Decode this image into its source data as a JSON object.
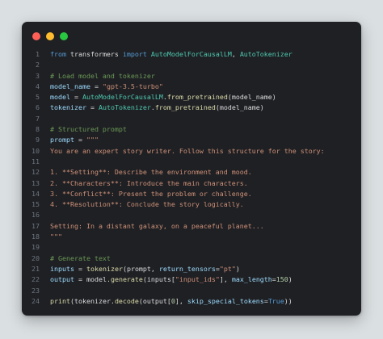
{
  "window": {
    "buttons": [
      "close",
      "minimize",
      "maximize"
    ],
    "colors": {
      "close": "#ff5f57",
      "minimize": "#febc2e",
      "maximize": "#28c840",
      "background": "#1f2024"
    }
  },
  "code_lines": [
    {
      "n": "1",
      "tokens": [
        [
          "kw",
          "from"
        ],
        [
          "plain",
          " transformers "
        ],
        [
          "kw",
          "import"
        ],
        [
          "plain",
          " "
        ],
        [
          "cls",
          "AutoModelForCausalLM"
        ],
        [
          "plain",
          ", "
        ],
        [
          "cls",
          "AutoTokenizer"
        ]
      ]
    },
    {
      "n": "2",
      "tokens": []
    },
    {
      "n": "3",
      "tokens": [
        [
          "com",
          "# Load model and tokenizer"
        ]
      ]
    },
    {
      "n": "4",
      "tokens": [
        [
          "var",
          "model_name"
        ],
        [
          "plain",
          " = "
        ],
        [
          "str",
          "\"gpt-3.5-turbo\""
        ]
      ]
    },
    {
      "n": "5",
      "tokens": [
        [
          "var",
          "model"
        ],
        [
          "plain",
          " = "
        ],
        [
          "cls",
          "AutoModelForCausalLM"
        ],
        [
          "plain",
          "."
        ],
        [
          "fn",
          "from_pretrained"
        ],
        [
          "plain",
          "(model_name)"
        ]
      ]
    },
    {
      "n": "6",
      "tokens": [
        [
          "var",
          "tokenizer"
        ],
        [
          "plain",
          " = "
        ],
        [
          "cls",
          "AutoTokenizer"
        ],
        [
          "plain",
          "."
        ],
        [
          "fn",
          "from_pretrained"
        ],
        [
          "plain",
          "(model_name)"
        ]
      ]
    },
    {
      "n": "7",
      "tokens": []
    },
    {
      "n": "8",
      "tokens": [
        [
          "com",
          "# Structured prompt"
        ]
      ]
    },
    {
      "n": "9",
      "tokens": [
        [
          "var",
          "prompt"
        ],
        [
          "plain",
          " = "
        ],
        [
          "str",
          "\"\"\""
        ]
      ]
    },
    {
      "n": "10",
      "tokens": [
        [
          "str",
          "You are an expert story writer. Follow this structure for the story:"
        ]
      ]
    },
    {
      "n": "11",
      "tokens": []
    },
    {
      "n": "12",
      "tokens": [
        [
          "str",
          "1. **Setting**: Describe the environment and mood."
        ]
      ]
    },
    {
      "n": "13",
      "tokens": [
        [
          "str",
          "2. **Characters**: Introduce the main characters."
        ]
      ]
    },
    {
      "n": "14",
      "tokens": [
        [
          "str",
          "3. **Conflict**: Present the problem or challenge."
        ]
      ]
    },
    {
      "n": "15",
      "tokens": [
        [
          "str",
          "4. **Resolution**: Conclude the story logically."
        ]
      ]
    },
    {
      "n": "16",
      "tokens": []
    },
    {
      "n": "17",
      "tokens": [
        [
          "str",
          "Setting: In a distant galaxy, on a peaceful planet..."
        ]
      ]
    },
    {
      "n": "18",
      "tokens": [
        [
          "str",
          "\"\"\""
        ]
      ]
    },
    {
      "n": "19",
      "tokens": []
    },
    {
      "n": "20",
      "tokens": [
        [
          "com",
          "# Generate text"
        ]
      ]
    },
    {
      "n": "21",
      "tokens": [
        [
          "var",
          "inputs"
        ],
        [
          "plain",
          " = "
        ],
        [
          "fn",
          "tokenizer"
        ],
        [
          "plain",
          "(prompt, "
        ],
        [
          "var",
          "return_tensors"
        ],
        [
          "plain",
          "="
        ],
        [
          "str",
          "\"pt\""
        ],
        [
          "plain",
          ")"
        ]
      ]
    },
    {
      "n": "22",
      "tokens": [
        [
          "var",
          "output"
        ],
        [
          "plain",
          " = model."
        ],
        [
          "fn",
          "generate"
        ],
        [
          "plain",
          "(inputs["
        ],
        [
          "str",
          "\"input_ids\""
        ],
        [
          "plain",
          "], "
        ],
        [
          "var",
          "max_length"
        ],
        [
          "plain",
          "="
        ],
        [
          "num",
          "150"
        ],
        [
          "plain",
          ")"
        ]
      ]
    },
    {
      "n": "23",
      "tokens": []
    },
    {
      "n": "24",
      "tokens": [
        [
          "fn",
          "print"
        ],
        [
          "plain",
          "(tokenizer."
        ],
        [
          "fn",
          "decode"
        ],
        [
          "plain",
          "(output["
        ],
        [
          "num",
          "0"
        ],
        [
          "plain",
          "], "
        ],
        [
          "var",
          "skip_special_tokens"
        ],
        [
          "plain",
          "="
        ],
        [
          "kw",
          "True"
        ],
        [
          "plain",
          "))"
        ]
      ]
    }
  ]
}
